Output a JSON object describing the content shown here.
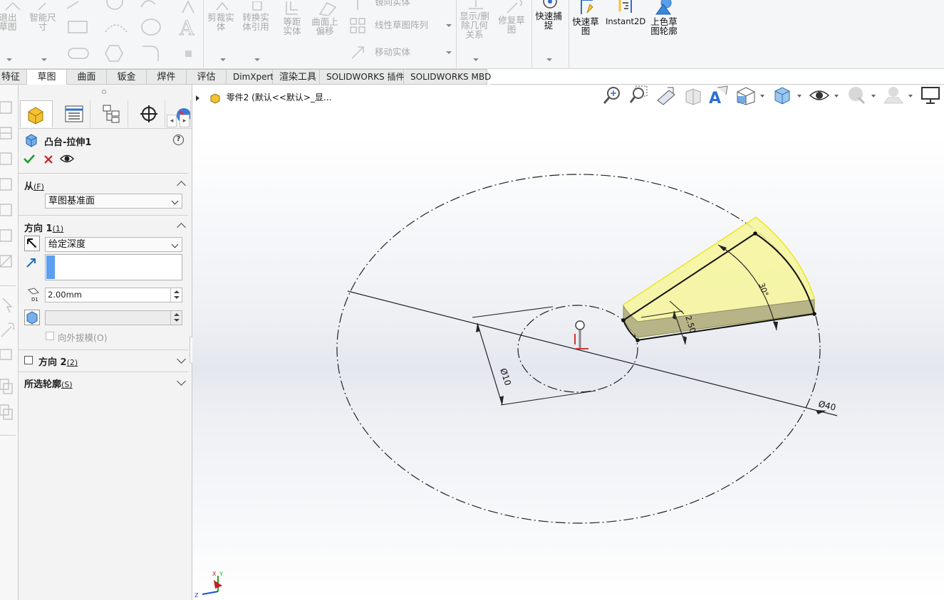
{
  "ribbon": {
    "exit_sketch": "退出草图",
    "smart_dimension": "智能尺寸",
    "trim": "剪裁实体",
    "convert": "转换实体引用",
    "offset": "等距实体",
    "surface_offset": "曲面上偏移",
    "mirror": "镜向实体",
    "linear_pattern": "线性草图阵列",
    "move": "移动实体",
    "display_delete": "显示/删除几何关系",
    "repair": "修复草图",
    "quick_snap": "快速捕捉",
    "rapid_sketch": "快速草图",
    "instant2d": "Instant2D",
    "shaded_sketch": "上色草图轮廓"
  },
  "tabs": [
    {
      "label": "特征"
    },
    {
      "label": "草图"
    },
    {
      "label": "曲面"
    },
    {
      "label": "钣金"
    },
    {
      "label": "焊件"
    },
    {
      "label": "评估"
    },
    {
      "label": "DimXpert"
    },
    {
      "label": "渲染工具"
    },
    {
      "label": "SOLIDWORKS 插件"
    },
    {
      "label": "SOLIDWORKS MBD"
    }
  ],
  "pm": {
    "title": "凸台-拉伸1",
    "from": {
      "heading": "从",
      "key": "(F)",
      "value": "草图基准面"
    },
    "dir1": {
      "heading": "方向 1",
      "key": "(1)",
      "end_condition": "给定深度",
      "depth": "2.00mm",
      "draft_outward": "向外拔模(O)"
    },
    "dir2": {
      "heading": "方向 2",
      "key": "(2)"
    },
    "contours": {
      "heading": "所选轮廓",
      "key": "(S)"
    }
  },
  "viewport": {
    "tree_label": "零件2  (默认<<默认>_显..."
  },
  "dims": {
    "small_circle": "Ø10",
    "large_circle": "Ø40",
    "angle": "30°",
    "width": "2.50"
  },
  "colors": {
    "accent_blue": "#5b9ff0",
    "preview_yellow": "#f6f59a",
    "check_green": "#1c9a2a",
    "cancel_red": "#cc1f1f"
  }
}
